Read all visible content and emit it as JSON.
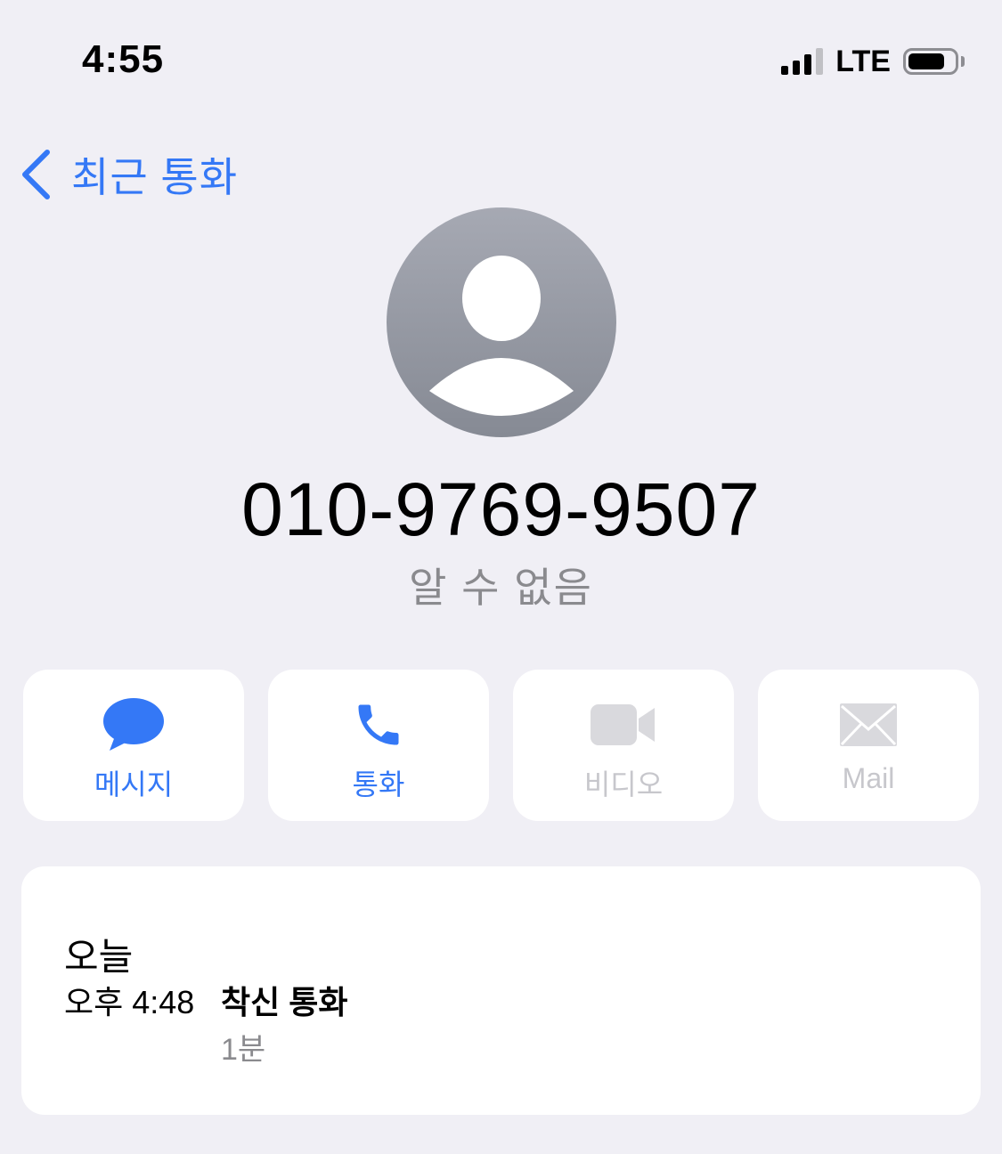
{
  "status_bar": {
    "time": "4:55",
    "network": "LTE",
    "signal_bars_active": 3,
    "signal_bars_total": 4,
    "battery_level_percent": 80
  },
  "nav": {
    "back_label": "최근 통화",
    "back_icon": "chevron-left-icon"
  },
  "contact": {
    "avatar_icon": "person-placeholder-icon",
    "number": "010-9769-9507",
    "label": "알 수 없음"
  },
  "actions": [
    {
      "label": "메시지",
      "icon": "message-bubble-icon",
      "enabled": true
    },
    {
      "label": "통화",
      "icon": "phone-icon",
      "enabled": true
    },
    {
      "label": "비디오",
      "icon": "video-camera-icon",
      "enabled": false
    },
    {
      "label": "Mail",
      "icon": "mail-envelope-icon",
      "enabled": false
    }
  ],
  "call_history": {
    "date_header": "오늘",
    "entries": [
      {
        "time": "오후 4:48",
        "type": "착신 통화",
        "duration": "1분"
      }
    ]
  },
  "colors": {
    "accent": "#3478f6",
    "background": "#f0eff5",
    "card": "#ffffff",
    "secondary_text": "#8a8a8e",
    "disabled": "#d9d9dd"
  }
}
